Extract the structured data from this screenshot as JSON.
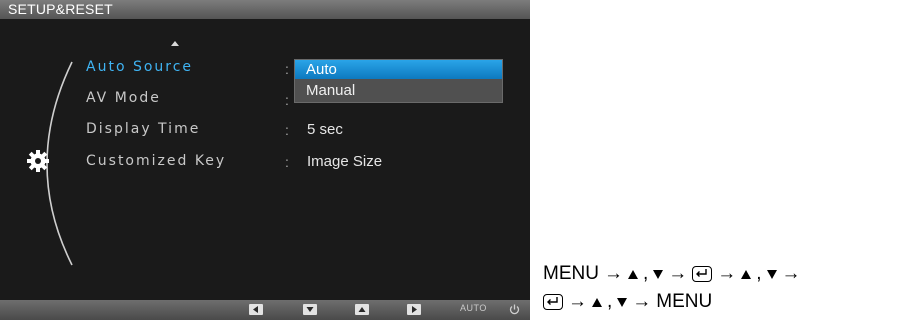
{
  "osd": {
    "title": "SETUP&RESET",
    "menu_items": [
      {
        "label": "Auto Source",
        "selected": true,
        "value": ""
      },
      {
        "label": "AV Mode",
        "selected": false,
        "value": ""
      },
      {
        "label": "Display Time",
        "selected": false,
        "value": "5 sec"
      },
      {
        "label": "Customized Key",
        "selected": false,
        "value": "Image Size"
      }
    ],
    "colon": ":",
    "dropdown_options": [
      {
        "label": "Auto",
        "active": true
      },
      {
        "label": "Manual",
        "active": false
      }
    ],
    "bottom_bar": {
      "buttons": [
        "left-arrow-icon",
        "down-arrow-icon",
        "up-arrow-icon",
        "right-arrow-icon"
      ],
      "auto_label": "AUTO",
      "power_icon": "power-icon"
    },
    "colors": {
      "selected_text": "#3fb3f2",
      "highlight": "#1a90d6",
      "panel_bg": "#1a1a1a"
    }
  },
  "instructions": {
    "line1": [
      "MENU",
      "→",
      "▲",
      ",",
      "▼",
      "→",
      "enter-icon",
      "→",
      "▲",
      ",",
      "▼",
      "→"
    ],
    "line2": [
      "enter-icon",
      "→",
      "▲",
      ",",
      "▼",
      "→",
      "MENU"
    ],
    "menu_word": "MENU",
    "arrow": "→",
    "comma": ","
  }
}
